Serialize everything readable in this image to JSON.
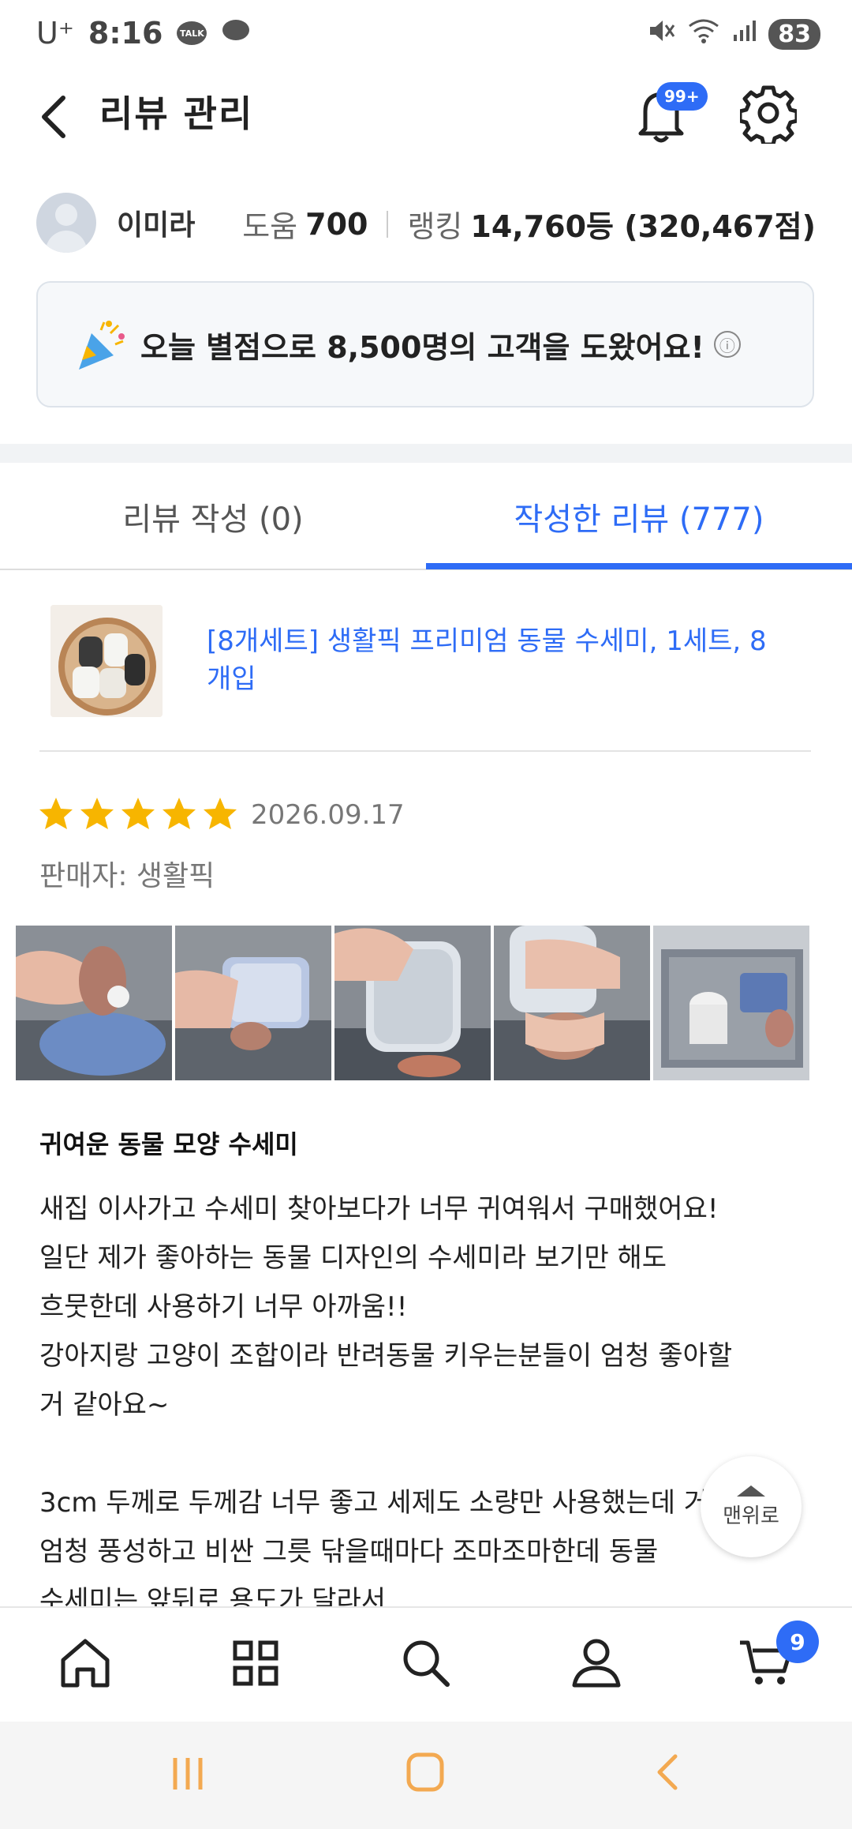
{
  "status_bar": {
    "carrier": "U⁺",
    "time": "8:16",
    "talk_badge": "TALK",
    "battery": "83"
  },
  "header": {
    "title": "리뷰 관리",
    "notification_badge": "99+"
  },
  "profile": {
    "name": "이미라",
    "help_label": "도움",
    "help_count": "700",
    "rank_label": "랭킹",
    "rank_value": "14,760등 (320,467점)"
  },
  "helped_banner": {
    "text": "오늘 별점으로 8,500명의 고객을 도왔어요!",
    "info_icon": "ⓘ"
  },
  "tabs": [
    {
      "label": "리뷰 작성 (0)",
      "active": false
    },
    {
      "label": "작성한 리뷰 (777)",
      "active": true
    }
  ],
  "product": {
    "name": "[8개세트] 생활픽 프리미엄 동물 수세미, 1세트, 8개입"
  },
  "review": {
    "rating": 5,
    "date": "2026.09.17",
    "seller": "판매자: 생활픽",
    "title": "귀여운 동물 모양 수세미",
    "body": "새집 이사가고 수세미 찾아보다가 너무 귀여워서 구매했어요!\n일단 제가 좋아하는 동물 디자인의 수세미라 보기만 해도\n흐뭇한데 사용하기 너무 아까움!!\n강아지랑 고양이 조합이라 반려동물 키우는분들이 엄청 좋아할\n거 같아요~\n\n3cm 두께로 두께감 너무 좋고 세제도 소량만 사용했는데 거품이\n엄청 풍성하고 비싼 그릇 닦을때마다 조마조마한데 동물\n수세미는 앞뒤로 용도가 달라서"
  },
  "top_button": {
    "label": "맨위로"
  },
  "bottom_nav": {
    "cart_badge": "9",
    "icons": [
      "home-icon",
      "grid-icon",
      "search-icon",
      "person-icon",
      "cart-icon"
    ]
  },
  "colors": {
    "accent": "#2e6cf6",
    "star": "#f7b500"
  }
}
